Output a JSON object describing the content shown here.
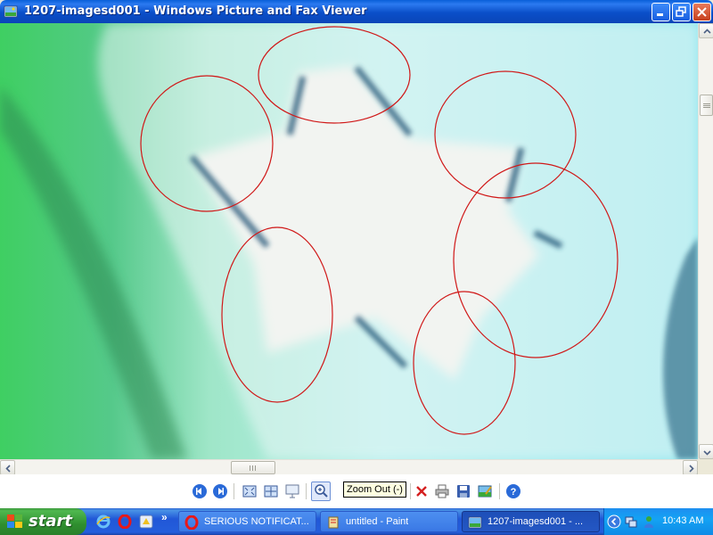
{
  "window": {
    "title": "1207-imagesd001 - Windows Picture and Fax Viewer",
    "icon": "picture-viewer-icon"
  },
  "image": {
    "subject": "blurry zoomed star shape with red circle annotations",
    "colors": {
      "green": "#3fbf5a",
      "cyan": "#a8ecec",
      "star": "#f0f3f0",
      "stroke": "#1f5a7a",
      "annotation": "#d01818"
    }
  },
  "toolbar": {
    "buttons": [
      {
        "name": "previous-image",
        "icon": "previous-icon"
      },
      {
        "name": "next-image",
        "icon": "next-icon"
      },
      {
        "name": "best-fit",
        "icon": "best-fit-icon"
      },
      {
        "name": "actual-size",
        "icon": "actual-size-icon"
      },
      {
        "name": "slide-show",
        "icon": "slideshow-icon"
      },
      {
        "name": "zoom-in",
        "icon": "zoom-in-icon"
      },
      {
        "name": "zoom-out",
        "icon": "zoom-out-icon"
      },
      {
        "name": "rotate-clockwise",
        "icon": "rotate-cw-icon"
      },
      {
        "name": "rotate-counterclockwise",
        "icon": "rotate-ccw-icon"
      },
      {
        "name": "delete",
        "icon": "delete-icon"
      },
      {
        "name": "print",
        "icon": "print-icon"
      },
      {
        "name": "copy-to",
        "icon": "save-icon"
      },
      {
        "name": "open-for-editing",
        "icon": "edit-icon"
      },
      {
        "name": "help",
        "icon": "help-icon"
      }
    ],
    "tooltip": "Zoom Out (-)"
  },
  "taskbar": {
    "start_label": "start",
    "quick_launch": [
      "internet-explorer-icon",
      "opera-icon",
      "aim-icon"
    ],
    "tasks": [
      {
        "label": "SERIOUS NOTIFICAT...",
        "icon": "opera-icon",
        "active": false
      },
      {
        "label": "untitled - Paint",
        "icon": "paint-icon",
        "active": false
      },
      {
        "label": "1207-imagesd001 - ...",
        "icon": "picture-viewer-icon",
        "active": true
      }
    ],
    "clock": "10:43 AM"
  }
}
